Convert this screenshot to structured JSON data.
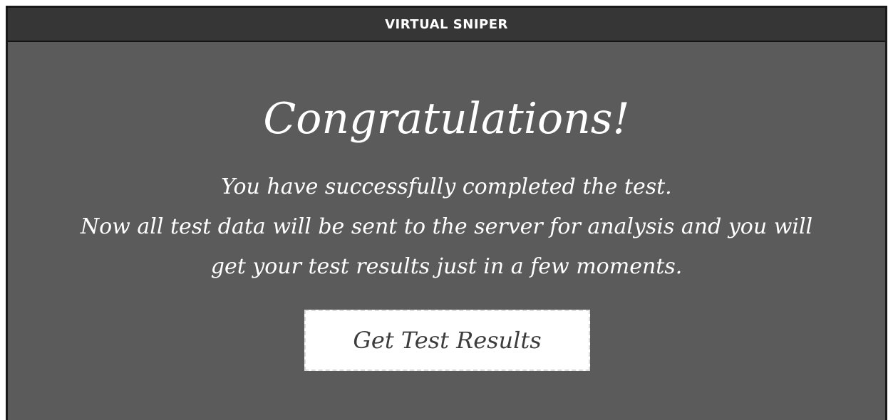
{
  "window": {
    "title": "VIRTUAL SNIPER"
  },
  "main": {
    "heading": "Congratulations!",
    "message_lines": [
      "You have successfully completed the test.",
      "Now all test data will be sent to the server for analysis and you will",
      "get your test results just in a few moments."
    ],
    "button_label": "Get Test Results"
  },
  "colors": {
    "background": "#5b5b5b",
    "titlebar": "#363636",
    "text": "#ffffff",
    "button_background": "#ffffff",
    "button_text": "#3c3c3c"
  }
}
